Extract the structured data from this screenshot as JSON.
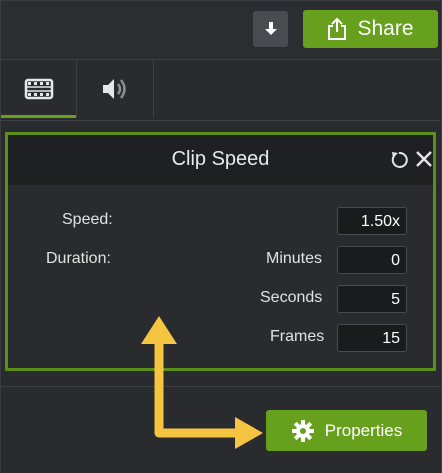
{
  "topbar": {
    "download_icon": "download-icon",
    "share_label": "Share",
    "share_icon": "share-icon"
  },
  "tabs": [
    {
      "name": "video",
      "icon": "film-icon",
      "active": true
    },
    {
      "name": "audio",
      "icon": "speaker-icon",
      "active": false
    }
  ],
  "panel": {
    "title": "Clip Speed",
    "reset_icon": "reset-icon",
    "close_icon": "close-icon",
    "speed_label": "Speed:",
    "speed_value": "1.50x",
    "duration_label": "Duration:",
    "minutes_label": "Minutes",
    "minutes_value": "0",
    "seconds_label": "Seconds",
    "seconds_value": "5",
    "frames_label": "Frames",
    "frames_value": "15"
  },
  "properties": {
    "label": "Properties",
    "icon": "gear-icon"
  },
  "colors": {
    "accent_green": "#67a01c",
    "highlight_border": "#5a8f1a",
    "annotation_arrow": "#f5c542"
  }
}
